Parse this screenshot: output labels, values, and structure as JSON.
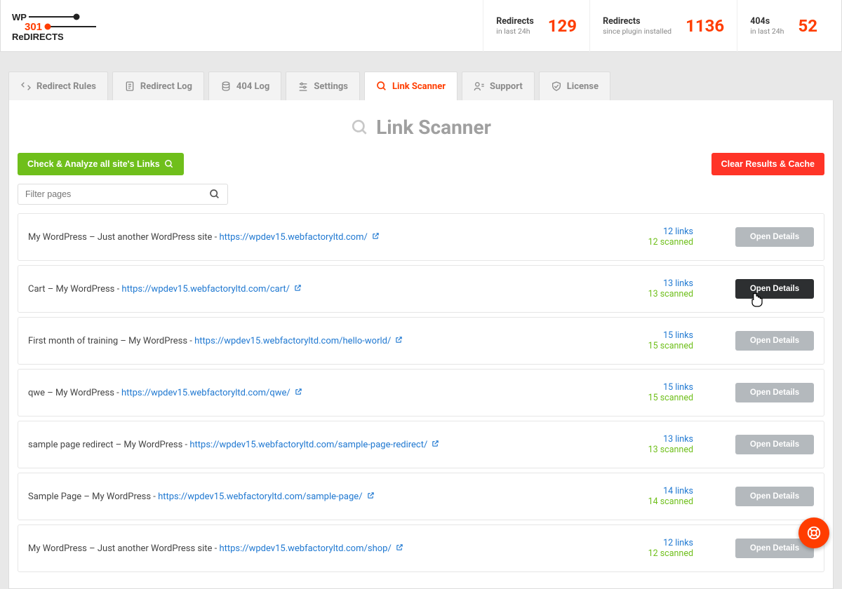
{
  "logo": {
    "wp": "WP",
    "num": "301",
    "redirects": "ReDIRECTS"
  },
  "stats": [
    {
      "title": "Redirects",
      "sub": "in last 24h",
      "value": "129"
    },
    {
      "title": "Redirects",
      "sub": "since plugin installed",
      "value": "1136"
    },
    {
      "title": "404s",
      "sub": "in last 24h",
      "value": "52"
    }
  ],
  "tabs": [
    {
      "label": "Redirect Rules",
      "icon": "arrows"
    },
    {
      "label": "Redirect Log",
      "icon": "doc"
    },
    {
      "label": "404 Log",
      "icon": "db"
    },
    {
      "label": "Settings",
      "icon": "sliders"
    },
    {
      "label": "Link Scanner",
      "icon": "search",
      "active": true
    },
    {
      "label": "Support",
      "icon": "support"
    },
    {
      "label": "License",
      "icon": "shield"
    }
  ],
  "page": {
    "title": "Link Scanner",
    "check_btn": "Check & Analyze all site's Links",
    "clear_btn": "Clear Results & Cache",
    "filter_placeholder": "Filter pages"
  },
  "open_details_label": "Open Details",
  "rows": [
    {
      "title": "My WordPress – Just another WordPress site - ",
      "url": "https://wpdev15.webfactoryltd.com/",
      "links": "12 links",
      "scanned": "12 scanned",
      "hover": false
    },
    {
      "title": "Cart – My WordPress - ",
      "url": "https://wpdev15.webfactoryltd.com/cart/",
      "links": "13 links",
      "scanned": "13 scanned",
      "hover": true
    },
    {
      "title": "First month of training – My WordPress - ",
      "url": "https://wpdev15.webfactoryltd.com/hello-world/",
      "links": "15 links",
      "scanned": "15 scanned",
      "hover": false
    },
    {
      "title": "qwe – My WordPress - ",
      "url": "https://wpdev15.webfactoryltd.com/qwe/",
      "links": "15 links",
      "scanned": "15 scanned",
      "hover": false
    },
    {
      "title": "sample page redirect – My WordPress - ",
      "url": "https://wpdev15.webfactoryltd.com/sample-page-redirect/",
      "links": "13 links",
      "scanned": "13 scanned",
      "hover": false
    },
    {
      "title": "Sample Page – My WordPress - ",
      "url": "https://wpdev15.webfactoryltd.com/sample-page/",
      "links": "14 links",
      "scanned": "14 scanned",
      "hover": false
    },
    {
      "title": "My WordPress – Just another WordPress site - ",
      "url": "https://wpdev15.webfactoryltd.com/shop/",
      "links": "12 links",
      "scanned": "12 scanned",
      "hover": false
    }
  ]
}
